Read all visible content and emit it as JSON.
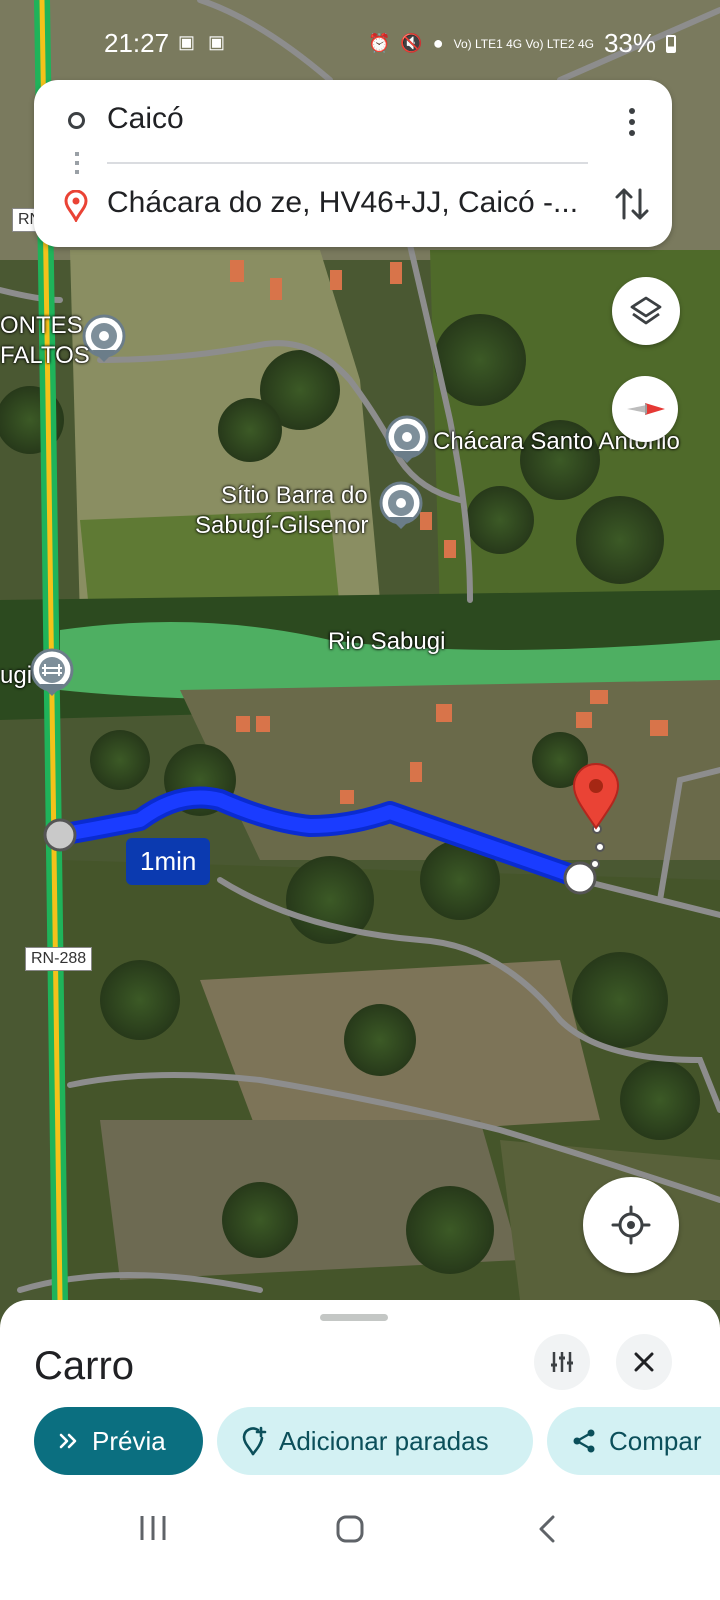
{
  "status_bar": {
    "time": "21:27",
    "network": "Vo) LTE1 4G Vo) LTE2 4G",
    "battery": "33%"
  },
  "directions": {
    "origin": "Caicó",
    "destination": "Chácara do ze, HV46+JJ, Caicó -..."
  },
  "map": {
    "labels": {
      "place_1": "ONTES",
      "place_1b": "FALTOS",
      "place_2": "Chácara Santo Antonio",
      "place_3a": "Sítio Barra do",
      "place_3b": "Sabugí-Gilsenor",
      "river": "Rio Sabugi",
      "place_4": "ugi"
    },
    "road_shields": {
      "rn_top": "RN",
      "rn_288": "RN-288"
    },
    "route_duration": "1min",
    "colors": {
      "route": "#1a3cff",
      "route_label": "#0b3ab0",
      "destination_pin": "#ea4335",
      "highway": "#1fb35a",
      "highway_center": "#f4c21a"
    }
  },
  "bottom_sheet": {
    "mode": "Carro",
    "preview_label": "Prévia",
    "add_stops_label": "Adicionar paradas",
    "share_label": "Compar"
  },
  "icons": {
    "layers": "layers-icon",
    "compass": "compass-icon",
    "locate": "my-location-icon",
    "options": "tune-icon",
    "close": "close-icon",
    "swap": "swap-vertical-icon",
    "more": "more-vert-icon"
  }
}
